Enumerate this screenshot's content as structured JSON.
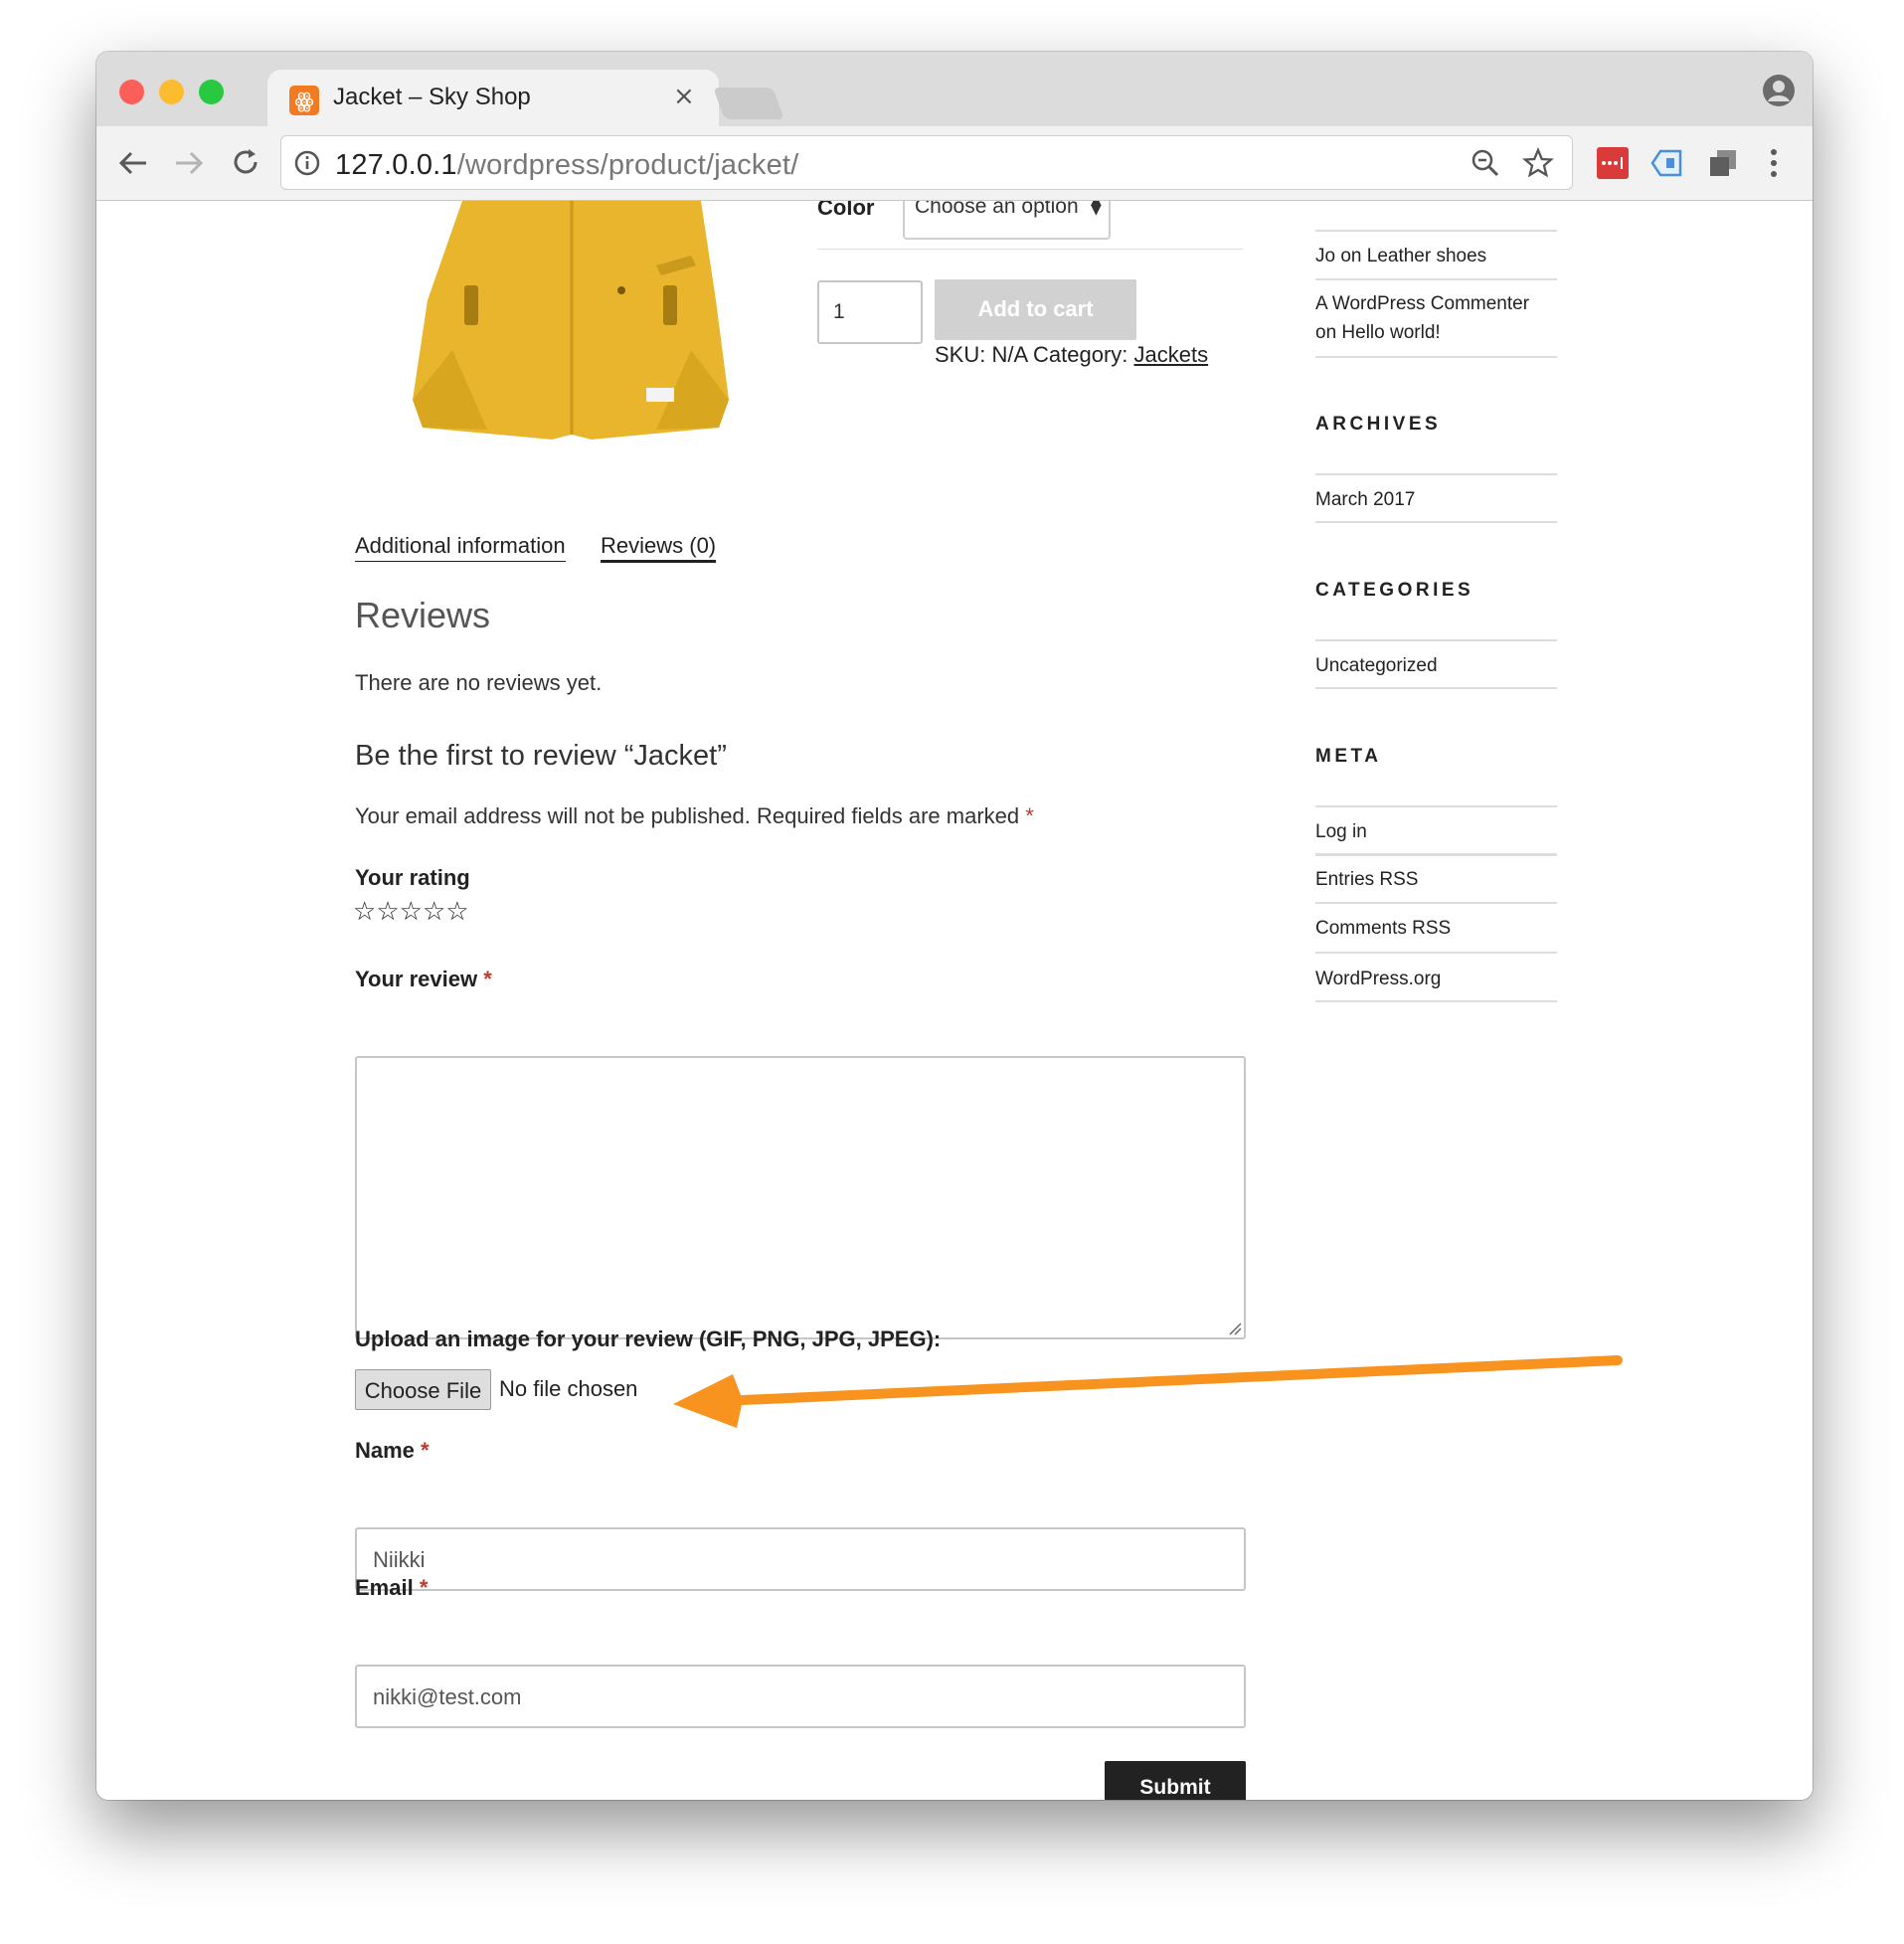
{
  "browser": {
    "tab_title": "Jacket – Sky Shop",
    "tab_icon": "xampp-logo-icon",
    "url_host": "127.0.0.1",
    "url_path": "/wordpress/product/jacket/"
  },
  "product": {
    "color_label": "Color",
    "color_select": "Choose an option",
    "quantity": "1",
    "add_to_cart": "Add to cart",
    "sku_text": "SKU: N/A Category: ",
    "category_link": "Jackets"
  },
  "tabs": [
    {
      "label": "Additional information"
    },
    {
      "label": "Reviews (0)"
    }
  ],
  "reviews": {
    "heading": "Reviews",
    "empty_text": "There are no reviews yet.",
    "form_title": "Be the first to review “Jacket”",
    "notice": "Your email address will not be published. Required fields are marked ",
    "required_mark": "*",
    "rating_label": "Your rating",
    "review_label": "Your review ",
    "upload_label": "Upload an image for your review (GIF, PNG, JPG, JPEG):",
    "choose_file": "Choose File",
    "no_file": "No file chosen",
    "name_label": "Name ",
    "name_value": "Niikki",
    "email_label": "Email ",
    "email_value": "nikki@test.com",
    "submit": "Submit"
  },
  "sidebar": {
    "recent_comments": [
      {
        "text": "Jo on Leather shoes"
      },
      {
        "line1": "A WordPress Commenter",
        "line2": "on Hello world!"
      }
    ],
    "archives_title": "ARCHIVES",
    "archives": [
      "March 2017"
    ],
    "categories_title": "CATEGORIES",
    "categories": [
      "Uncategorized"
    ],
    "meta_title": "META",
    "meta": [
      "Log in",
      "Entries RSS",
      "Comments RSS",
      "WordPress.org"
    ]
  },
  "colors": {
    "accent_arrow": "#f7931e",
    "submit_bg": "#222222",
    "add_to_cart_bg": "#d1d1d1",
    "jacket": "#e8b52c"
  }
}
